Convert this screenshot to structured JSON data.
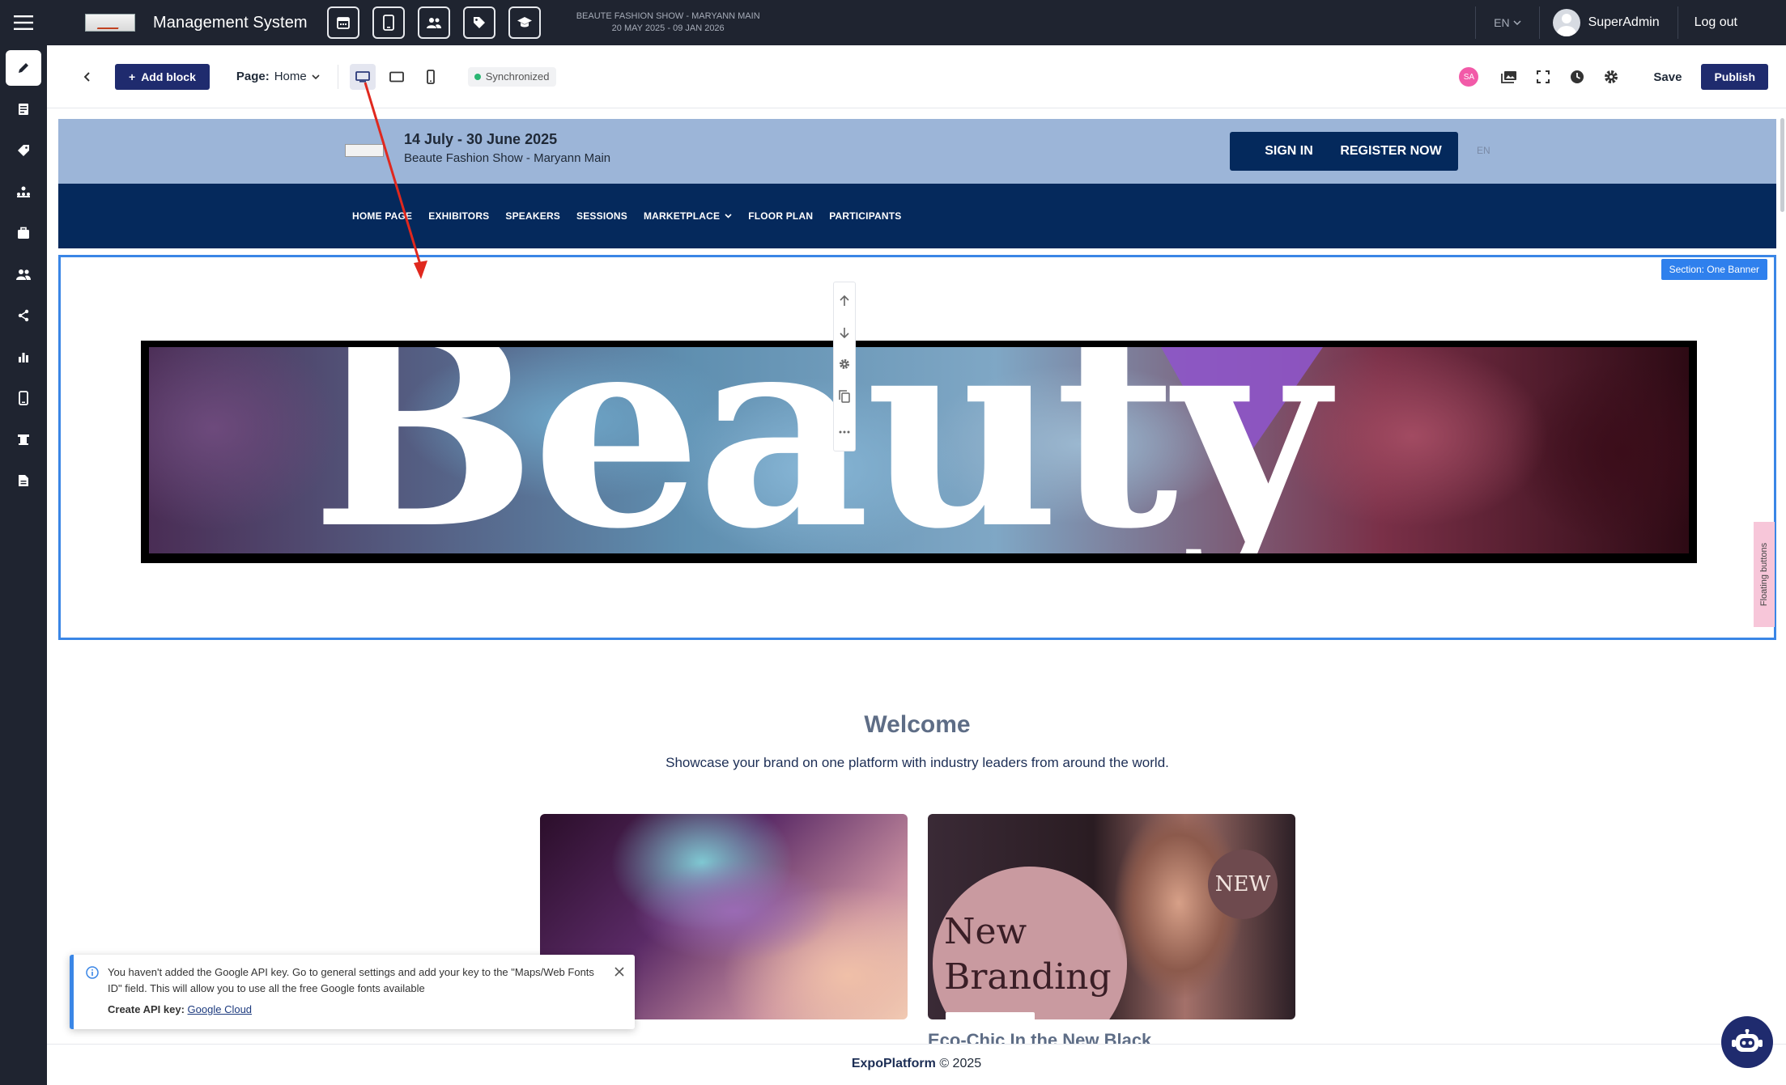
{
  "topbar": {
    "app_title": "Management System",
    "event_name": "BEAUTE FASHION SHOW - MARYANN MAIN",
    "event_dates": "20 MAY 2025 - 09 JAN 2026",
    "lang": "EN",
    "user_name": "SuperAdmin",
    "logout_label": "Log out",
    "icons": [
      "calendar-icon",
      "tablet-icon",
      "users-icon",
      "tag-icon",
      "graduation-cap-icon"
    ]
  },
  "sidebar": {
    "items": [
      "pencil-icon",
      "document-list-icon",
      "tag-icon",
      "org-chart-icon",
      "briefcase-icon",
      "people-icon",
      "share-icon",
      "bar-chart-icon",
      "mobile-icon",
      "podium-icon",
      "file-icon"
    ],
    "active_index": 0
  },
  "editor": {
    "add_block_label": "Add block",
    "page_label": "Page:",
    "page_value": "Home",
    "sync_label": "Synchronized",
    "avatar_initials": "SA",
    "save_label": "Save",
    "publish_label": "Publish"
  },
  "site": {
    "date_range": "14 July - 30 June 2025",
    "event_name": "Beaute Fashion Show - Maryann Main",
    "sign_in_label": "SIGN IN",
    "register_label": "REGISTER NOW",
    "lang": "EN",
    "nav": [
      "HOME PAGE",
      "EXHIBITORS",
      "SPEAKERS",
      "SESSIONS",
      "MARKETPLACE",
      "FLOOR PLAN",
      "PARTICIPANTS"
    ],
    "banner_section_label": "Section: One Banner",
    "banner_text": "Beauty",
    "floating_buttons_label": "Floating buttons",
    "welcome_title": "Welcome",
    "welcome_subtitle": "Showcase your brand on one platform with industry leaders from around the world.",
    "card2_heading_line1": "New",
    "card2_heading_line2": "Branding",
    "card2_badge": "NEW",
    "card2_caption_partial": "Eco-Chic In the New Black"
  },
  "toast": {
    "message": "You haven't added the Google API key. Go to general settings and add your key to the \"Maps/Web Fonts ID\" field. This will allow you to use all the free Google fonts available",
    "api_key_label": "Create API key:",
    "api_key_link": "Google Cloud"
  },
  "footer": {
    "brand": "ExpoPlatform",
    "copyright": "© 2025"
  },
  "colors": {
    "topbar_bg": "#1f2430",
    "primary": "#1f2b6e",
    "site_header": "#9cb5d8",
    "site_nav": "#05295c",
    "selection": "#3a86e6"
  }
}
